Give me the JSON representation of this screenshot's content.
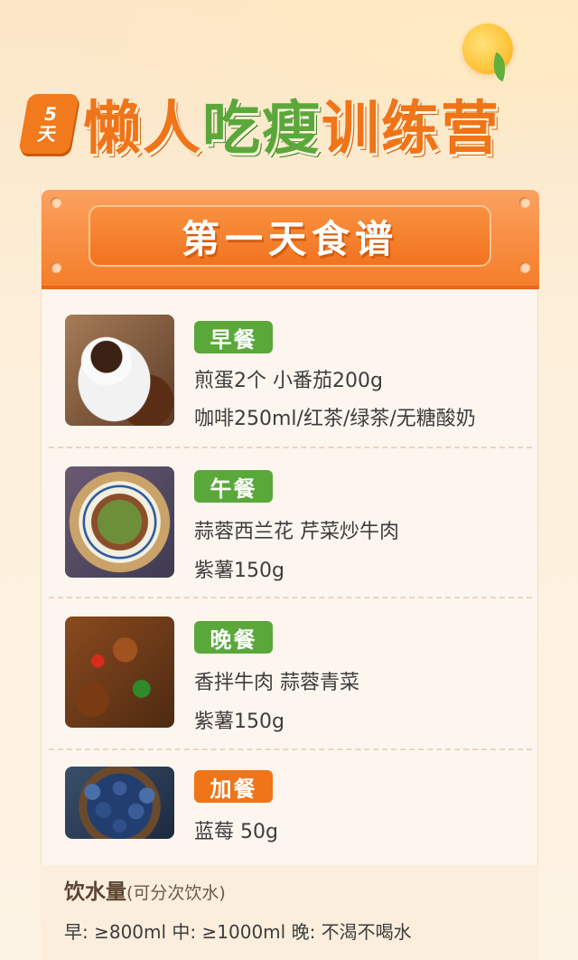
{
  "header": {
    "badge_line1": "5",
    "badge_line2": "天",
    "title_part1": "懒人",
    "title_part2": "吃瘦",
    "title_part3": "训练营"
  },
  "banner": {
    "title": "第一天食谱"
  },
  "meals": [
    {
      "tag": "早餐",
      "tag_color": "#5aa83a",
      "lines": [
        "煎蛋2个  小番茄200g",
        "咖啡250ml/红茶/绿茶/无糖酸奶"
      ],
      "image": "coffee-photo"
    },
    {
      "tag": "午餐",
      "tag_color": "#5aa83a",
      "lines": [
        "蒜蓉西兰花   芹菜炒牛肉",
        "紫薯150g"
      ],
      "image": "beef-celery-photo"
    },
    {
      "tag": "晚餐",
      "tag_color": "#5aa83a",
      "lines": [
        "香拌牛肉   蒜蓉青菜",
        "紫薯150g"
      ],
      "image": "spicy-beef-photo"
    },
    {
      "tag": "加餐",
      "tag_color": "#f07418",
      "lines": [
        "蓝莓 50g"
      ],
      "image": "blueberry-photo"
    }
  ],
  "water": {
    "title": "饮水量",
    "subtitle": "(可分次饮水)",
    "detail": "早: ≥800ml  中: ≥1000ml  晚: 不渴不喝水"
  }
}
